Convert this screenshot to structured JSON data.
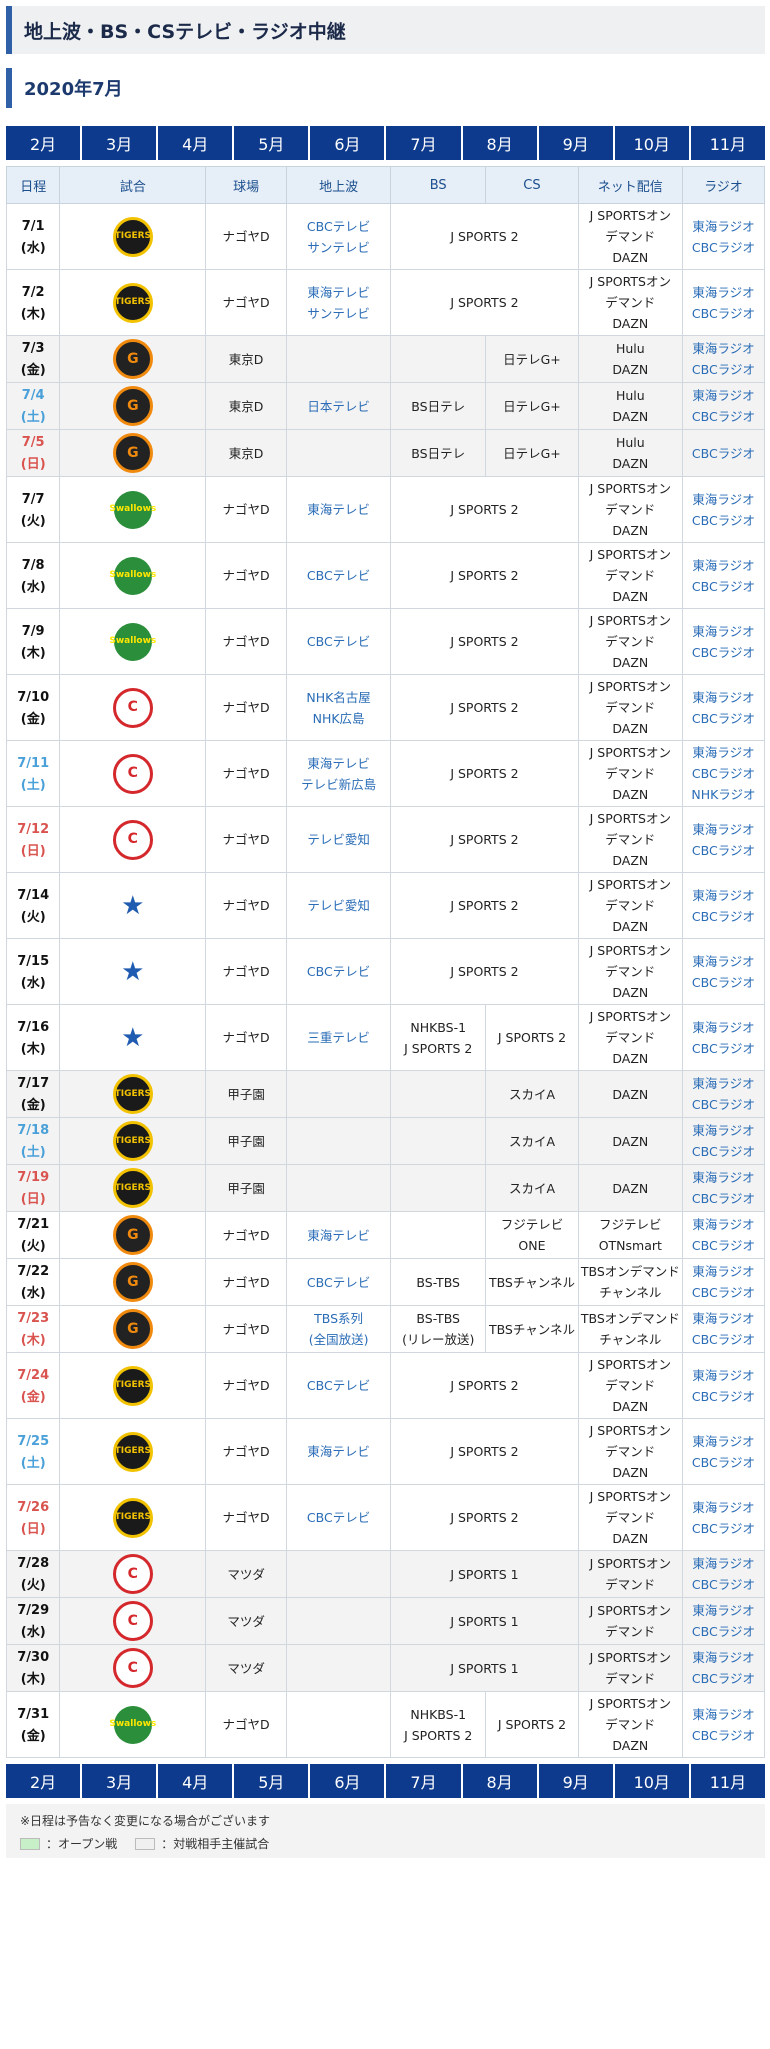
{
  "page_title": "地上波・BS・CSテレビ・ラジオ中継",
  "section_title": "2020年7月",
  "months": [
    "2月",
    "3月",
    "4月",
    "5月",
    "6月",
    "7月",
    "8月",
    "9月",
    "10月",
    "11月"
  ],
  "headers": [
    "日程",
    "試合",
    "球場",
    "地上波",
    "BS",
    "CS",
    "ネット配信",
    "ラジオ"
  ],
  "colors": {
    "accent": "#0d3a8c",
    "saturday": "#4aa0d8",
    "sunday": "#d9534f",
    "link": "#2a6cb6"
  },
  "rows": [
    {
      "d": "7/1",
      "w": "(水)",
      "day": "",
      "team": "T",
      "logo": "TIGERS",
      "venue": "ナゴヤD",
      "tv": [
        "CBCテレビ",
        "サンテレビ"
      ],
      "bs": "J SPORTS 2",
      "bsSpan": true,
      "cs": "",
      "net": [
        "J SPORTSオン",
        "デマンド",
        "DAZN"
      ],
      "radio": [
        "東海ラジオ",
        "CBCラジオ"
      ],
      "gray": false,
      "h": 56
    },
    {
      "d": "7/2",
      "w": "(木)",
      "day": "",
      "team": "T",
      "logo": "TIGERS",
      "venue": "ナゴヤD",
      "tv": [
        "東海テレビ",
        "サンテレビ"
      ],
      "bs": "J SPORTS 2",
      "bsSpan": true,
      "cs": "",
      "net": [
        "J SPORTSオン",
        "デマンド",
        "DAZN"
      ],
      "radio": [
        "東海ラジオ",
        "CBCラジオ"
      ],
      "gray": false,
      "h": 56
    },
    {
      "d": "7/3",
      "w": "(金)",
      "day": "",
      "team": "G",
      "logo": "G",
      "venue": "東京D",
      "tv": [],
      "bs": "",
      "bsSpan": false,
      "cs": "日テレG+",
      "net": [
        "Hulu",
        "DAZN"
      ],
      "radio": [
        "東海ラジオ",
        "CBCラジオ"
      ],
      "gray": true,
      "h": 40
    },
    {
      "d": "7/4",
      "w": "(土)",
      "day": "sat",
      "team": "G",
      "logo": "G",
      "venue": "東京D",
      "tv": [
        "日本テレビ"
      ],
      "bs": "BS日テレ",
      "bsSpan": false,
      "cs": "日テレG+",
      "net": [
        "Hulu",
        "DAZN"
      ],
      "radio": [
        "東海ラジオ",
        "CBCラジオ"
      ],
      "gray": true,
      "h": 40
    },
    {
      "d": "7/5",
      "w": "(日)",
      "day": "sun",
      "team": "G",
      "logo": "G",
      "venue": "東京D",
      "tv": [],
      "bs": "BS日テレ",
      "bsSpan": false,
      "cs": "日テレG+",
      "net": [
        "Hulu",
        "DAZN"
      ],
      "radio": [
        "CBCラジオ"
      ],
      "gray": true,
      "h": 40
    },
    {
      "d": "7/7",
      "w": "(火)",
      "day": "",
      "team": "S",
      "logo": "Swallows",
      "venue": "ナゴヤD",
      "tv": [
        "東海テレビ"
      ],
      "bs": "J SPORTS 2",
      "bsSpan": true,
      "cs": "",
      "net": [
        "J SPORTSオン",
        "デマンド",
        "DAZN"
      ],
      "radio": [
        "東海ラジオ",
        "CBCラジオ"
      ],
      "gray": false,
      "h": 56
    },
    {
      "d": "7/8",
      "w": "(水)",
      "day": "",
      "team": "S",
      "logo": "Swallows",
      "venue": "ナゴヤD",
      "tv": [
        "CBCテレビ"
      ],
      "bs": "J SPORTS 2",
      "bsSpan": true,
      "cs": "",
      "net": [
        "J SPORTSオン",
        "デマンド",
        "DAZN"
      ],
      "radio": [
        "東海ラジオ",
        "CBCラジオ"
      ],
      "gray": false,
      "h": 56
    },
    {
      "d": "7/9",
      "w": "(木)",
      "day": "",
      "team": "S",
      "logo": "Swallows",
      "venue": "ナゴヤD",
      "tv": [
        "CBCテレビ"
      ],
      "bs": "J SPORTS 2",
      "bsSpan": true,
      "cs": "",
      "net": [
        "J SPORTSオン",
        "デマンド",
        "DAZN"
      ],
      "radio": [
        "東海ラジオ",
        "CBCラジオ"
      ],
      "gray": false,
      "h": 56
    },
    {
      "d": "7/10",
      "w": "(金)",
      "day": "",
      "team": "C",
      "logo": "C",
      "venue": "ナゴヤD",
      "tv": [
        "NHK名古屋",
        "NHK広島"
      ],
      "bs": "J SPORTS 2",
      "bsSpan": true,
      "cs": "",
      "net": [
        "J SPORTSオン",
        "デマンド",
        "DAZN"
      ],
      "radio": [
        "東海ラジオ",
        "CBCラジオ"
      ],
      "gray": false,
      "h": 56
    },
    {
      "d": "7/11",
      "w": "(土)",
      "day": "sat",
      "team": "C",
      "logo": "C",
      "venue": "ナゴヤD",
      "tv": [
        "東海テレビ",
        "テレビ新広島"
      ],
      "bs": "J SPORTS 2",
      "bsSpan": true,
      "cs": "",
      "net": [
        "J SPORTSオン",
        "デマンド",
        "DAZN"
      ],
      "radio": [
        "東海ラジオ",
        "CBCラジオ",
        "NHKラジオ"
      ],
      "gray": false,
      "h": 56
    },
    {
      "d": "7/12",
      "w": "(日)",
      "day": "sun",
      "team": "C",
      "logo": "C",
      "venue": "ナゴヤD",
      "tv": [
        "テレビ愛知"
      ],
      "bs": "J SPORTS 2",
      "bsSpan": true,
      "cs": "",
      "net": [
        "J SPORTSオン",
        "デマンド",
        "DAZN"
      ],
      "radio": [
        "東海ラジオ",
        "CBCラジオ"
      ],
      "gray": false,
      "h": 56
    },
    {
      "d": "7/14",
      "w": "(火)",
      "day": "",
      "team": "DB",
      "logo": "★",
      "venue": "ナゴヤD",
      "tv": [
        "テレビ愛知"
      ],
      "bs": "J SPORTS 2",
      "bsSpan": true,
      "cs": "",
      "net": [
        "J SPORTSオン",
        "デマンド",
        "DAZN"
      ],
      "radio": [
        "東海ラジオ",
        "CBCラジオ"
      ],
      "gray": false,
      "h": 56
    },
    {
      "d": "7/15",
      "w": "(水)",
      "day": "",
      "team": "DB",
      "logo": "★",
      "venue": "ナゴヤD",
      "tv": [
        "CBCテレビ"
      ],
      "bs": "J SPORTS 2",
      "bsSpan": true,
      "cs": "",
      "net": [
        "J SPORTSオン",
        "デマンド",
        "DAZN"
      ],
      "radio": [
        "東海ラジオ",
        "CBCラジオ"
      ],
      "gray": false,
      "h": 56
    },
    {
      "d": "7/16",
      "w": "(木)",
      "day": "",
      "team": "DB",
      "logo": "★",
      "venue": "ナゴヤD",
      "tv": [
        "三重テレビ"
      ],
      "bs": "NHKBS-1\nJ SPORTS 2",
      "bsSpan": false,
      "cs": "J SPORTS 2",
      "net": [
        "J SPORTSオン",
        "デマンド",
        "DAZN"
      ],
      "radio": [
        "東海ラジオ",
        "CBCラジオ"
      ],
      "gray": false,
      "h": 56
    },
    {
      "d": "7/17",
      "w": "(金)",
      "day": "",
      "team": "T",
      "logo": "TIGERS",
      "venue": "甲子園",
      "tv": [],
      "bs": "",
      "bsSpan": false,
      "cs": "スカイA",
      "net": [
        "DAZN"
      ],
      "radio": [
        "東海ラジオ",
        "CBCラジオ"
      ],
      "gray": true,
      "h": 40
    },
    {
      "d": "7/18",
      "w": "(土)",
      "day": "sat",
      "team": "T",
      "logo": "TIGERS",
      "venue": "甲子園",
      "tv": [],
      "bs": "",
      "bsSpan": false,
      "cs": "スカイA",
      "net": [
        "DAZN"
      ],
      "radio": [
        "東海ラジオ",
        "CBCラジオ"
      ],
      "gray": true,
      "h": 40
    },
    {
      "d": "7/19",
      "w": "(日)",
      "day": "sun",
      "team": "T",
      "logo": "TIGERS",
      "venue": "甲子園",
      "tv": [],
      "bs": "",
      "bsSpan": false,
      "cs": "スカイA",
      "net": [
        "DAZN"
      ],
      "radio": [
        "東海ラジオ",
        "CBCラジオ"
      ],
      "gray": true,
      "h": 40
    },
    {
      "d": "7/21",
      "w": "(火)",
      "day": "",
      "team": "G",
      "logo": "G",
      "venue": "ナゴヤD",
      "tv": [
        "東海テレビ"
      ],
      "bs": "",
      "bsSpan": false,
      "cs": "フジテレビONE",
      "net": [
        "フジテレビ",
        "OTNsmart"
      ],
      "radio": [
        "東海ラジオ",
        "CBCラジオ"
      ],
      "gray": false,
      "h": 40
    },
    {
      "d": "7/22",
      "w": "(水)",
      "day": "",
      "team": "G",
      "logo": "G",
      "venue": "ナゴヤD",
      "tv": [
        "CBCテレビ"
      ],
      "bs": "BS-TBS",
      "bsSpan": false,
      "cs": "TBSチャンネル",
      "net": [
        "TBSオンデマンド",
        "チャンネル"
      ],
      "radio": [
        "東海ラジオ",
        "CBCラジオ"
      ],
      "gray": false,
      "h": 40
    },
    {
      "d": "7/23",
      "w": "(木)",
      "day": "sun",
      "team": "G",
      "logo": "G",
      "venue": "ナゴヤD",
      "tv": [
        "TBS系列",
        "(全国放送)"
      ],
      "bs": "BS-TBS\n(リレー放送)",
      "bsSpan": false,
      "cs": "TBSチャンネル",
      "net": [
        "TBSオンデマンド",
        "チャンネル"
      ],
      "radio": [
        "東海ラジオ",
        "CBCラジオ"
      ],
      "gray": false,
      "h": 40
    },
    {
      "d": "7/24",
      "w": "(金)",
      "day": "sun",
      "team": "T",
      "logo": "TIGERS",
      "venue": "ナゴヤD",
      "tv": [
        "CBCテレビ"
      ],
      "bs": "J SPORTS 2",
      "bsSpan": true,
      "cs": "",
      "net": [
        "J SPORTSオン",
        "デマンド",
        "DAZN"
      ],
      "radio": [
        "東海ラジオ",
        "CBCラジオ"
      ],
      "gray": false,
      "h": 56
    },
    {
      "d": "7/25",
      "w": "(土)",
      "day": "sat",
      "team": "T",
      "logo": "TIGERS",
      "venue": "ナゴヤD",
      "tv": [
        "東海テレビ"
      ],
      "bs": "J SPORTS 2",
      "bsSpan": true,
      "cs": "",
      "net": [
        "J SPORTSオン",
        "デマンド",
        "DAZN"
      ],
      "radio": [
        "東海ラジオ",
        "CBCラジオ"
      ],
      "gray": false,
      "h": 56
    },
    {
      "d": "7/26",
      "w": "(日)",
      "day": "sun",
      "team": "T",
      "logo": "TIGERS",
      "venue": "ナゴヤD",
      "tv": [
        "CBCテレビ"
      ],
      "bs": "J SPORTS 2",
      "bsSpan": true,
      "cs": "",
      "net": [
        "J SPORTSオン",
        "デマンド",
        "DAZN"
      ],
      "radio": [
        "東海ラジオ",
        "CBCラジオ"
      ],
      "gray": false,
      "h": 56
    },
    {
      "d": "7/28",
      "w": "(火)",
      "day": "",
      "team": "C",
      "logo": "C",
      "venue": "マツダ",
      "tv": [],
      "bs": "J SPORTS 1",
      "bsSpan": true,
      "cs": "",
      "net": [
        "J SPORTSオン",
        "デマンド"
      ],
      "radio": [
        "東海ラジオ",
        "CBCラジオ"
      ],
      "gray": true,
      "h": 40
    },
    {
      "d": "7/29",
      "w": "(水)",
      "day": "",
      "team": "C",
      "logo": "C",
      "venue": "マツダ",
      "tv": [],
      "bs": "J SPORTS 1",
      "bsSpan": true,
      "cs": "",
      "net": [
        "J SPORTSオン",
        "デマンド"
      ],
      "radio": [
        "東海ラジオ",
        "CBCラジオ"
      ],
      "gray": true,
      "h": 40
    },
    {
      "d": "7/30",
      "w": "(木)",
      "day": "",
      "team": "C",
      "logo": "C",
      "venue": "マツダ",
      "tv": [],
      "bs": "J SPORTS 1",
      "bsSpan": true,
      "cs": "",
      "net": [
        "J SPORTSオン",
        "デマンド"
      ],
      "radio": [
        "東海ラジオ",
        "CBCラジオ"
      ],
      "gray": true,
      "h": 40
    },
    {
      "d": "7/31",
      "w": "(金)",
      "day": "",
      "team": "S",
      "logo": "Swallows",
      "venue": "ナゴヤD",
      "tv": [],
      "bs": "NHKBS-1\nJ SPORTS 2",
      "bsSpan": false,
      "cs": "J SPORTS 2",
      "net": [
        "J SPORTSオン",
        "デマンド",
        "DAZN"
      ],
      "radio": [
        "東海ラジオ",
        "CBCラジオ"
      ],
      "gray": false,
      "h": 56
    }
  ],
  "footer_note": "※日程は予告なく変更になる場合がございます",
  "legend": {
    "open": "：オープン戦",
    "opponent": "：対戦相手主催試合"
  }
}
